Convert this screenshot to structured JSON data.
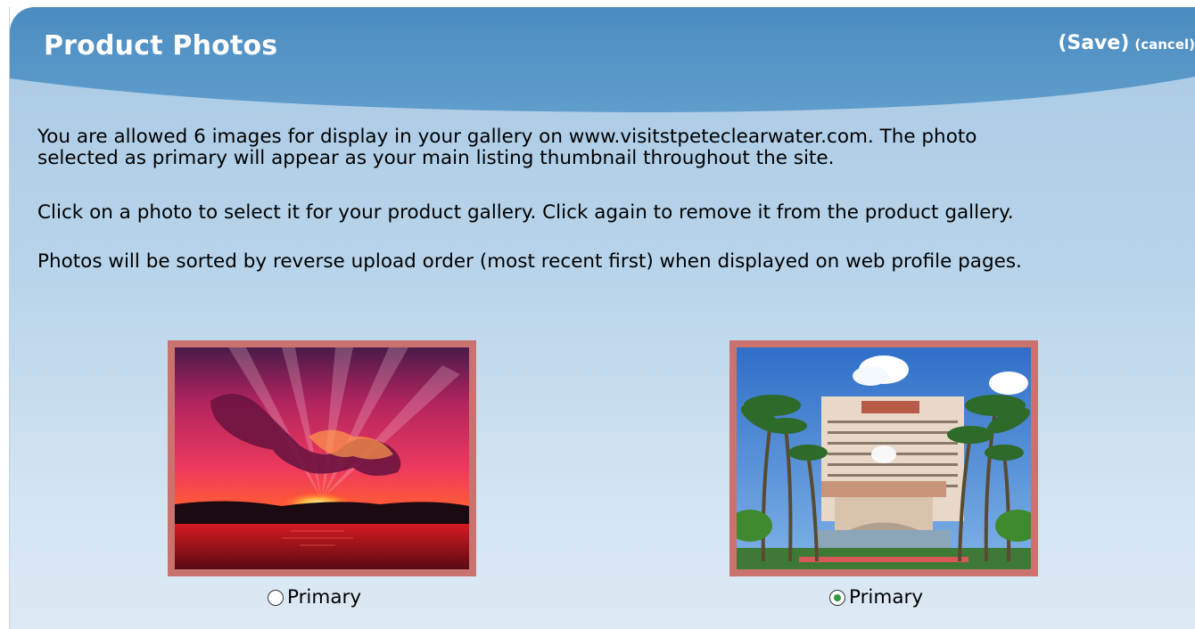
{
  "panel": {
    "title": "Product Photos",
    "save_label": "(Save)",
    "cancel_label": "(cancel)"
  },
  "instructions": {
    "allowance_line1": "You are allowed 6 images for display in your gallery on www.visitstpeteclearwater.com. The photo",
    "allowance_line2": "selected as primary will appear as your main listing thumbnail throughout the site.",
    "select_text": "Click on a photo to select it for your product gallery. Click again to remove it from the product gallery.",
    "sort_text": "Photos will be sorted by reverse upload order (most recent first) when displayed on web profile pages."
  },
  "photos": [
    {
      "subject": "sunset over water",
      "primary_label": "Primary",
      "primary_selected": false,
      "selected_in_gallery": true
    },
    {
      "subject": "Hilton hotel with palm trees",
      "primary_label": "Primary",
      "primary_selected": true,
      "selected_in_gallery": true
    }
  ],
  "colors": {
    "header_blue": "#4f8fc2",
    "panel_light": "#b8d4ea",
    "selected_frame": "#c9726e",
    "radio_dot": "#2f9b3a"
  }
}
